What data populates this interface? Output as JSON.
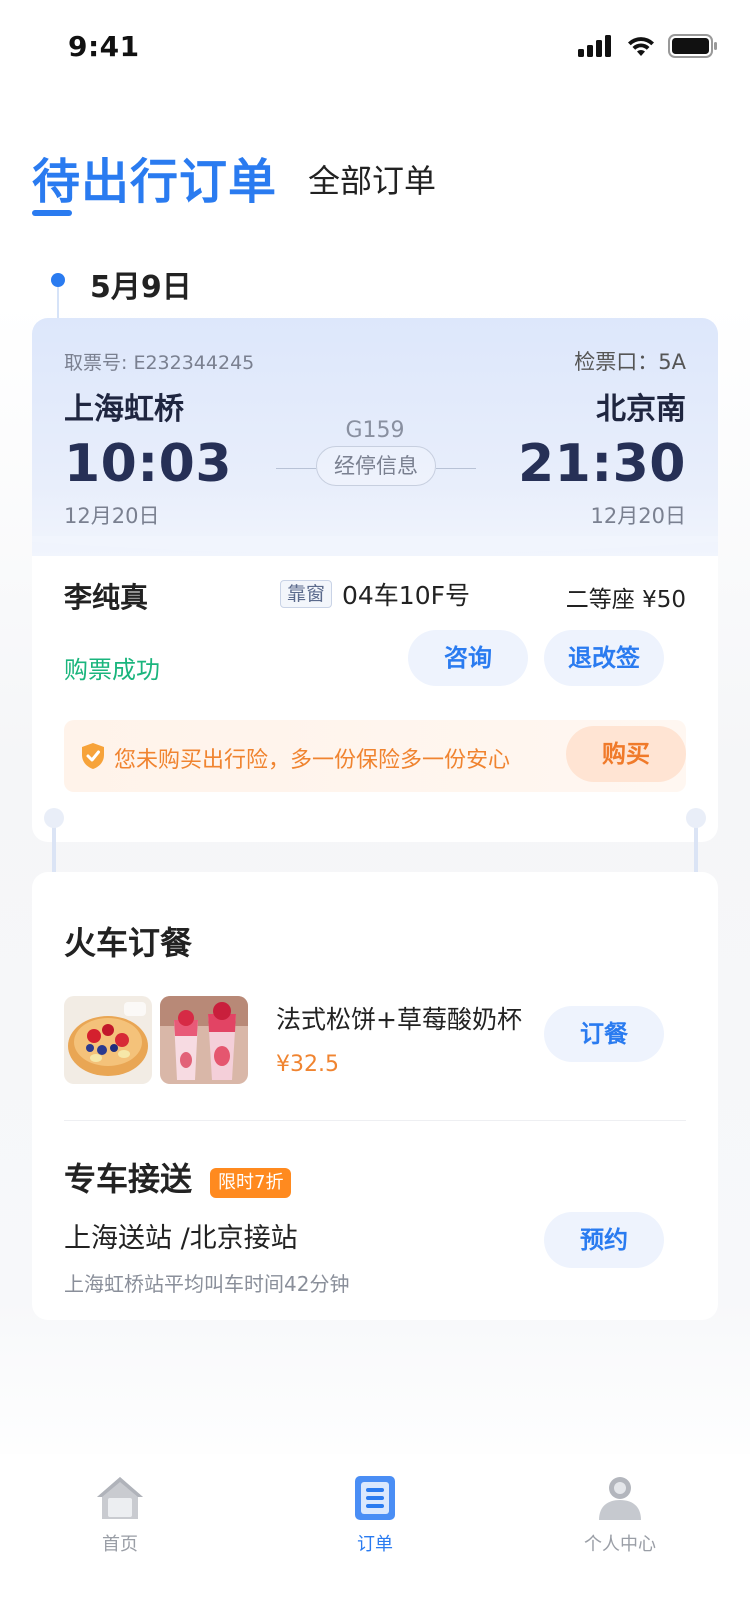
{
  "status_bar": {
    "time": "9:41",
    "icons": [
      "signal-icon",
      "wifi-icon",
      "battery-icon"
    ]
  },
  "tabs": {
    "active": "待出行订单",
    "inactive": "全部订单"
  },
  "trip": {
    "date": "5月9日",
    "ticket_no": "取票号: E232344245",
    "gate": "检票口：5A",
    "from_station": "上海虹桥",
    "to_station": "北京南",
    "depart_time": "10:03",
    "arrive_time": "21:30",
    "depart_date": "12月20日",
    "arrive_date": "12月20日",
    "train_no": "G159",
    "stops_label": "经停信息",
    "passenger": "李纯真",
    "window_tag": "靠窗",
    "seat": "04车10F号",
    "class_price": "二等座 ¥50",
    "status": "购票成功",
    "consult_label": "咨询",
    "change_label": "退改签",
    "insurance_text": "您未购买出行险，多一份保险多一份安心",
    "buy_label": "购买"
  },
  "meal": {
    "title": "火车订餐",
    "item_name": "法式松饼+草莓酸奶杯",
    "price": "¥32.5",
    "order_label": "订餐"
  },
  "transfer": {
    "title": "专车接送",
    "discount": "限时7折",
    "route": "上海送站 /北京接站",
    "subtitle": "上海虹桥站平均叫车时间42分钟",
    "reserve_label": "预约"
  },
  "tabbar": [
    {
      "label": "首页",
      "icon": "home-icon"
    },
    {
      "label": "订单",
      "icon": "orders-icon"
    },
    {
      "label": "个人中心",
      "icon": "profile-icon"
    }
  ],
  "colors": {
    "accent": "#2a7bf0",
    "success": "#1ab57d",
    "warning": "#f08430",
    "tag": "#ff8a1f"
  }
}
